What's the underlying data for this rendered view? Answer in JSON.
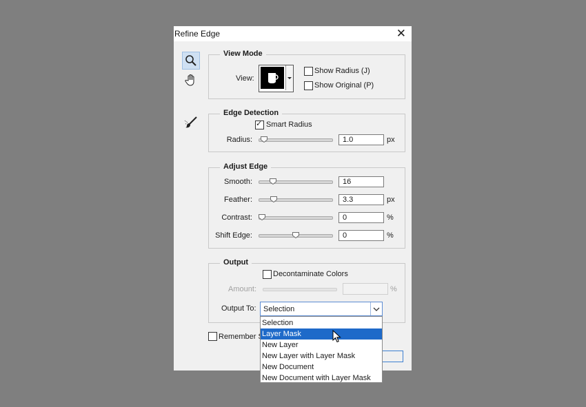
{
  "dialog": {
    "title": "Refine Edge",
    "close_glyph": "✕"
  },
  "tools": [
    "zoom-icon",
    "hand-icon",
    "refine-radius-brush-icon"
  ],
  "view_mode": {
    "legend": "View Mode",
    "view_label": "View:",
    "show_radius": {
      "label": "Show Radius (J)",
      "checked": false
    },
    "show_original": {
      "label": "Show Original (P)",
      "checked": false
    }
  },
  "edge_detection": {
    "legend": "Edge Detection",
    "smart_radius": {
      "label": "Smart Radius",
      "checked": true
    },
    "radius": {
      "label": "Radius:",
      "value": "1.0",
      "unit": "px",
      "slider_fraction": 0.03
    }
  },
  "adjust_edge": {
    "legend": "Adjust Edge",
    "smooth": {
      "label": "Smooth:",
      "value": "16",
      "unit": "",
      "slider_fraction": 0.16
    },
    "feather": {
      "label": "Feather:",
      "value": "3.3",
      "unit": "px",
      "slider_fraction": 0.17
    },
    "contrast": {
      "label": "Contrast:",
      "value": "0",
      "unit": "%",
      "slider_fraction": 0.0
    },
    "shift_edge": {
      "label": "Shift Edge:",
      "value": "0",
      "unit": "%",
      "slider_fraction": 0.5
    }
  },
  "output": {
    "legend": "Output",
    "decontaminate": {
      "label": "Decontaminate Colors",
      "checked": false
    },
    "amount": {
      "label": "Amount:",
      "value": "",
      "unit": "%"
    },
    "output_to": {
      "label": "Output To:",
      "selected": "Selection",
      "options": [
        "Selection",
        "Layer Mask",
        "New Layer",
        "New Layer with Layer Mask",
        "New Document",
        "New Document with Layer Mask"
      ],
      "highlighted": "Layer Mask"
    }
  },
  "remember": {
    "label": "Remember Se",
    "checked": false
  },
  "colors": {
    "highlight": "#1e6ac9",
    "background": "#7f7f7f",
    "dialog": "#f0f0f0"
  }
}
